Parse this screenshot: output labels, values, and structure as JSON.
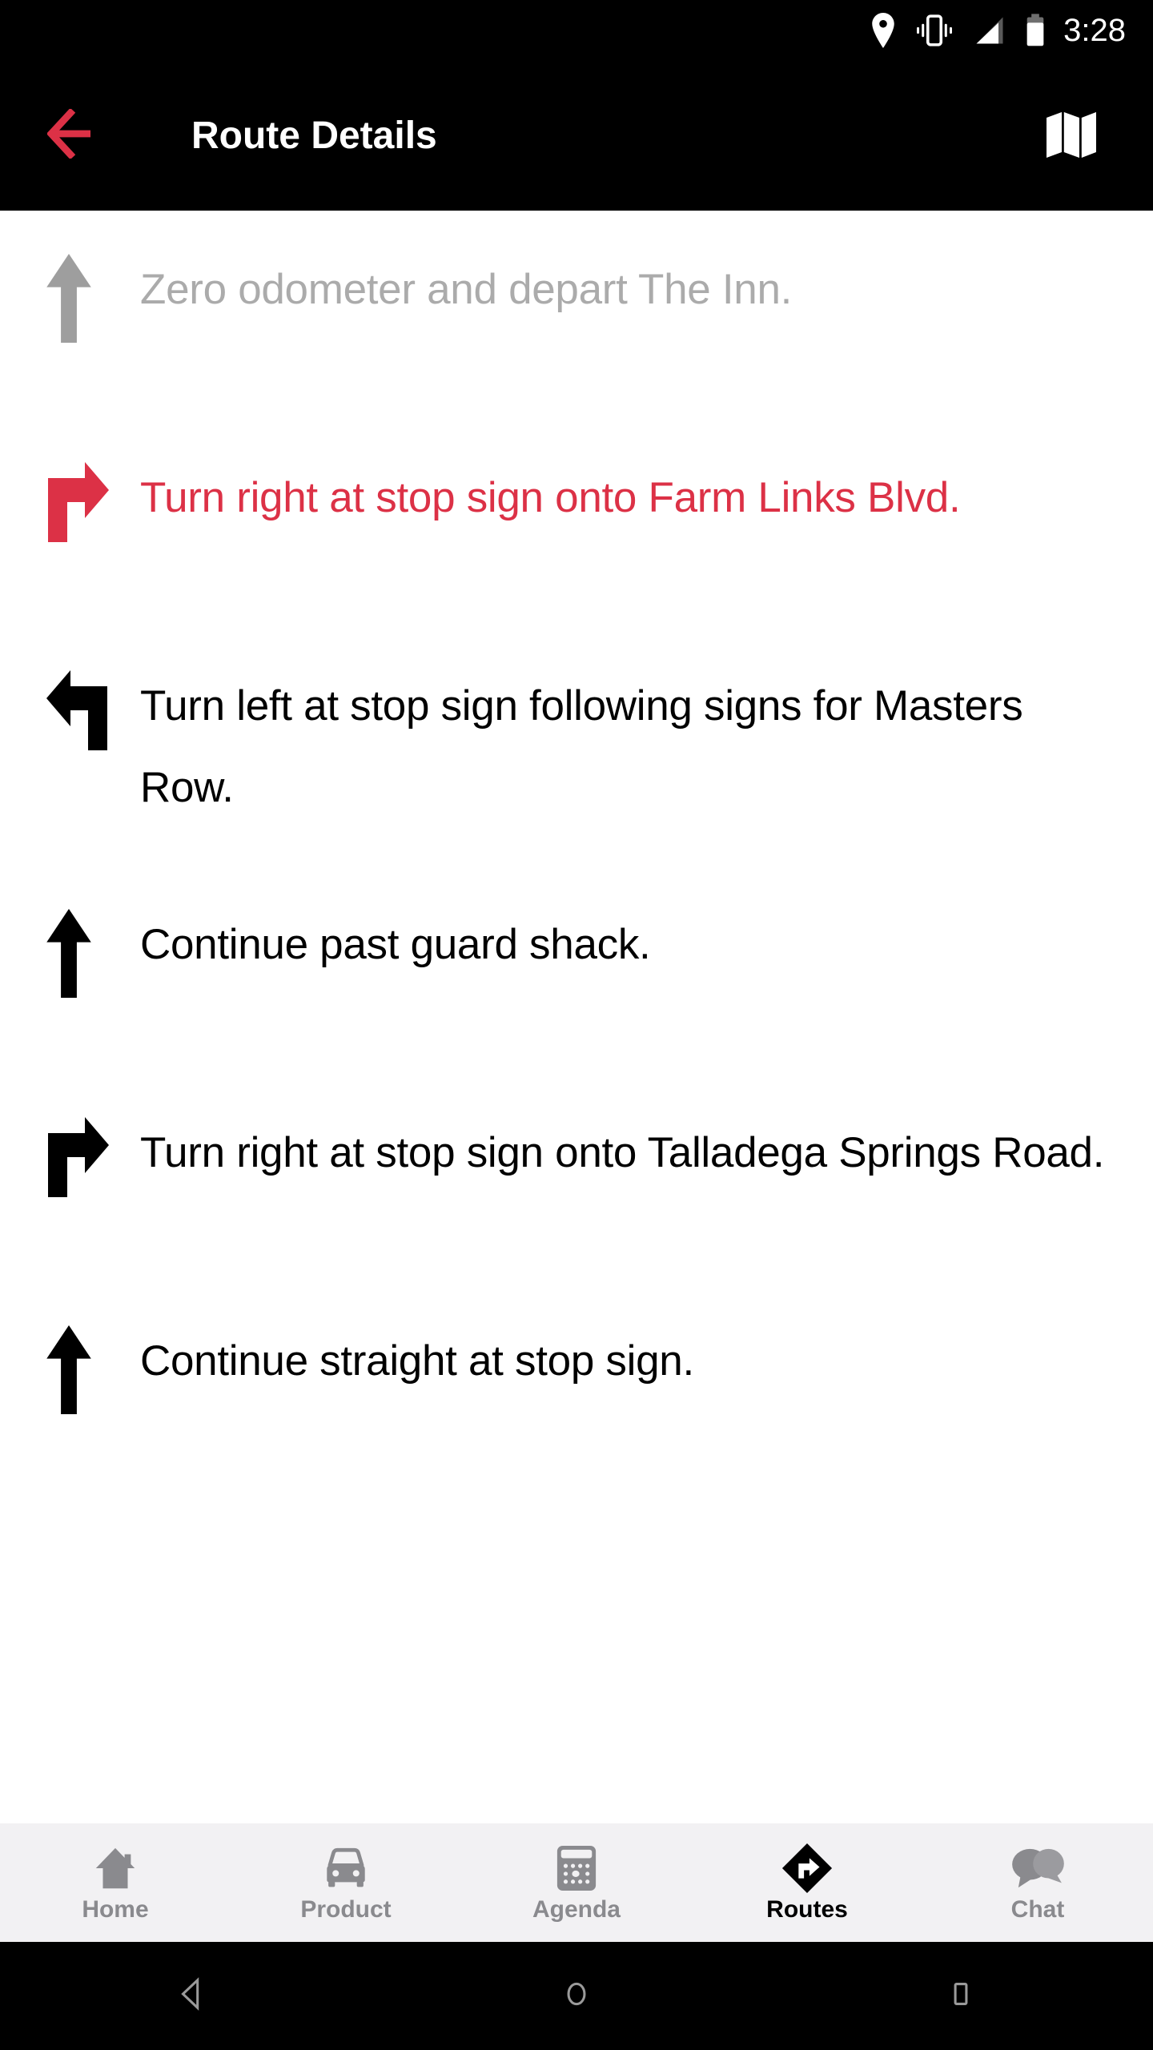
{
  "status_bar": {
    "time": "3:28",
    "icons": [
      "location-pin-icon",
      "vibrate-icon",
      "signal-icon",
      "battery-icon"
    ],
    "background": "#000000",
    "foreground": "#ffffff"
  },
  "app_bar": {
    "back_icon": "arrow-back-icon",
    "title": "Route Details",
    "map_icon": "map-icon",
    "background": "#000000",
    "accent": "#DC3146"
  },
  "colors": {
    "accent_red": "#DC3146",
    "past_grey": "#ababab",
    "active_black": "#000000",
    "nav_bg": "#F2F1F3",
    "nav_inactive": "#8A8A8E"
  },
  "route_steps": [
    {
      "icon": "arrow-straight-icon",
      "text": "Zero odometer and depart The Inn.",
      "state": "past"
    },
    {
      "icon": "arrow-turn-right-icon",
      "text": "Turn right at stop sign onto Farm Links Blvd.",
      "state": "current"
    },
    {
      "icon": "arrow-turn-left-icon",
      "text": "Turn left at stop sign following signs for Masters Row.",
      "state": "upcoming"
    },
    {
      "icon": "arrow-straight-icon",
      "text": "Continue past guard shack.",
      "state": "upcoming"
    },
    {
      "icon": "arrow-turn-right-icon",
      "text": "Turn right at stop sign onto Talladega Springs Road.",
      "state": "upcoming"
    },
    {
      "icon": "arrow-straight-icon",
      "text": "Continue straight at stop sign.",
      "state": "upcoming"
    }
  ],
  "bottom_nav": {
    "items": [
      {
        "label": "Home",
        "icon": "home-icon",
        "active": false
      },
      {
        "label": "Product",
        "icon": "car-icon",
        "active": false
      },
      {
        "label": "Agenda",
        "icon": "agenda-icon",
        "active": false
      },
      {
        "label": "Routes",
        "icon": "routes-diamond-icon",
        "active": true
      },
      {
        "label": "Chat",
        "icon": "chat-bubbles-icon",
        "active": false
      }
    ]
  },
  "system_nav": {
    "buttons": [
      "android-back-icon",
      "android-home-icon",
      "android-recents-icon"
    ],
    "background": "#000000",
    "icon_color": "#9a9a9a"
  }
}
